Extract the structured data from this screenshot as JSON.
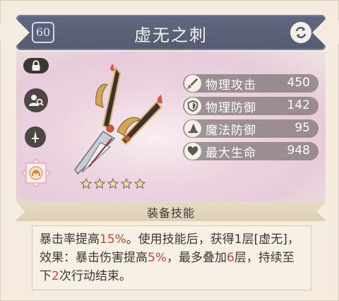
{
  "header": {
    "level": "60",
    "title": "虚无之刺"
  },
  "stars": {
    "count": 5,
    "filled": 5
  },
  "stats": [
    {
      "icon": "sword-icon",
      "label": "物理攻击",
      "value": "450"
    },
    {
      "icon": "shield-icon",
      "label": "物理防御",
      "value": "142"
    },
    {
      "icon": "wizard-hat-icon",
      "label": "魔法防御",
      "value": "95"
    },
    {
      "icon": "heart-icon",
      "label": "最大生命",
      "value": "948"
    }
  ],
  "skill": {
    "title": "装备技能",
    "segments": [
      {
        "text": "暴击率提高",
        "hl": false
      },
      {
        "text": "15%",
        "hl": true
      },
      {
        "text": "。使用技能后，获得1层[虚无]，效果：暴击伤害提高",
        "hl": false
      },
      {
        "text": "5%",
        "hl": true
      },
      {
        "text": "，最多叠加",
        "hl": false
      },
      {
        "text": "6",
        "hl": true
      },
      {
        "text": "层，持续至下",
        "hl": false
      },
      {
        "text": "2",
        "hl": true
      },
      {
        "text": "次行动结束。",
        "hl": false
      }
    ]
  },
  "colors": {
    "header_bg": "#5a6279",
    "highlight": "#c24a3a",
    "card_bg": "#f3ecdf"
  }
}
